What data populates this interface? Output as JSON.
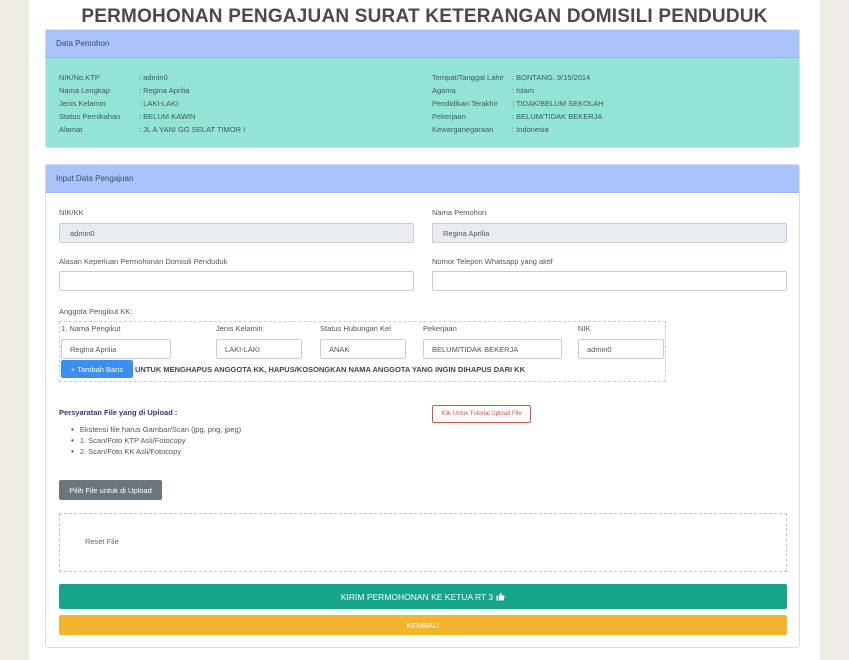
{
  "page": {
    "title": "PERMOHONAN PENGAJUAN SURAT KETERANGAN DOMISILI PENDUDUK"
  },
  "pemohon": {
    "header": "Data Pemohon",
    "left": [
      {
        "label": "NIK/No.KTP",
        "value": ": admin0"
      },
      {
        "label": "Nama Lengkap",
        "value": ": Regina Aprilia"
      },
      {
        "label": "Jenis Kelamin",
        "value": ": LAKI-LAKI"
      },
      {
        "label": "Status Pernikahan",
        "value": ": BELUM KAWIN"
      },
      {
        "label": "Alamat",
        "value": ": JL A YANI GG SELAT TIMOR I"
      }
    ],
    "right": [
      {
        "label": "Tempat/Tanggal Lahir",
        "value": ": BONTANG, 9/15/2014"
      },
      {
        "label": "Agama",
        "value": ": Islam"
      },
      {
        "label": "Pendidikan Terakhir",
        "value": ": TIDAK/BELUM SEKOLAH"
      },
      {
        "label": "Pekerjaan",
        "value": ": BELUM/TIDAK BEKERJA"
      },
      {
        "label": "Kewarganegaraan",
        "value": ": Indonesia"
      }
    ]
  },
  "form": {
    "header": "Input Data Pengajuan",
    "nik_label": "NIK/KK",
    "nik_value": "admin0",
    "nama_label": "Nama Pemohon",
    "nama_value": "Regina Aprilia",
    "alasan_label": "Alasan Keperluan Permohonan Domisili Penduduk",
    "alasan_value": "",
    "telp_label": "Nomor Telepon Whatsapp yang aktif",
    "telp_value": "",
    "anggota_label": "Anggota Pengikut KK:",
    "anggota_columns": [
      "1. Nama Pengikut",
      "Jenis Kelamin",
      "Status Hubungan Kel",
      "Pekerjaan",
      "NIK"
    ],
    "anggota_row": [
      "Regina Aprilia",
      "LAKI-LAKI",
      "ANAK",
      "BELUM/TIDAK BEKERJA",
      "admin0"
    ],
    "tambah_label": "+ Tambah Baris",
    "hapus_hint": "UNTUK MENGHAPUS ANGGOTA KK, HAPUS/KOSONGKAN NAMA ANGGOTA YANG INGIN DIHAPUS DARI KK",
    "persyaratan_title": "Persyaratan File yang di Upload :",
    "persyaratan_items": [
      "Ekstensi file harus Gambar/Scan (jpg, png, jpeg)",
      "1. Scan/Foto KTP Asli/Fotocopy",
      "2. Scan/Foto KK Asli/Fotocopy"
    ],
    "tutorial_label": "Klik Untuk Tutorial Upload File",
    "pilih_file_label": "Pilih File untuk di Upload",
    "reset_label": "Reset File",
    "kirim_label": "KIRIM PERMOHONAN KE KETUA RT 3",
    "kembali_label": "KEMBALI"
  },
  "colors": {
    "header_bg": "#a9c3fb",
    "info_bg": "#93e4d6",
    "primary": "#3b8ef2",
    "success": "#17a589",
    "warning": "#f3b32c",
    "danger": "#d9534f"
  }
}
